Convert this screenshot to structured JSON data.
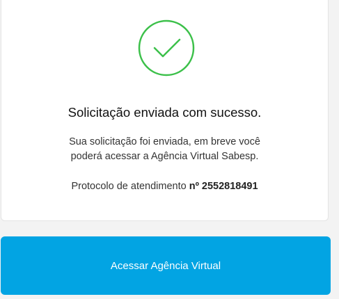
{
  "success_card": {
    "icon": "check-circle-icon",
    "icon_color": "#3cc04a",
    "title": "Solicitação enviada com sucesso.",
    "message_line1": "Sua solicitação foi enviada, em breve você",
    "message_line2": "poderá acessar a Agência Virtual Sabesp.",
    "protocol_label": "Protocolo de atendimento",
    "protocol_number": "nº 2552818491"
  },
  "action": {
    "button_label": "Acessar Agência Virtual",
    "button_color": "#02a4e3"
  }
}
